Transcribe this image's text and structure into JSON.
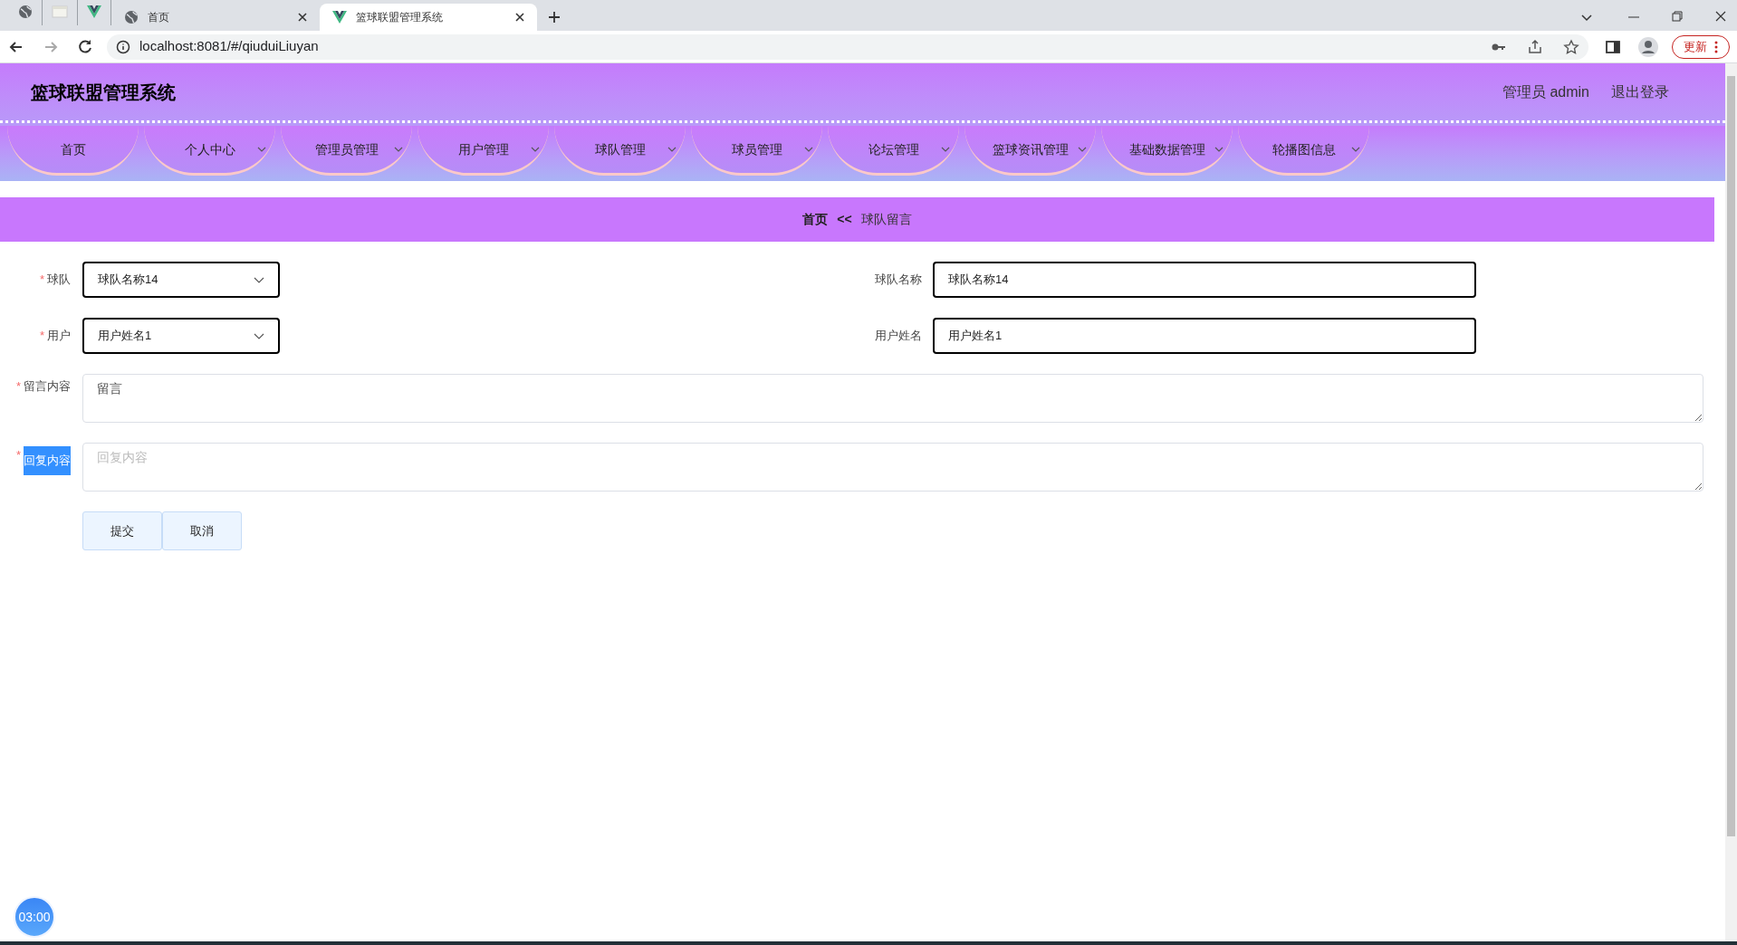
{
  "browser": {
    "tabs": [
      {
        "kind": "globe",
        "selected": false
      },
      {
        "kind": "page",
        "selected": false
      },
      {
        "kind": "vue",
        "selected": false
      },
      {
        "kind": "globe",
        "title": "首页",
        "selected": false
      },
      {
        "kind": "vue",
        "title": "篮球联盟管理系统",
        "selected": true
      }
    ],
    "url": "localhost:8081/#/qiuduiLiuyan",
    "update_label": "更新"
  },
  "header": {
    "title": "篮球联盟管理系统",
    "user": "管理员 admin",
    "logout": "退出登录"
  },
  "nav": [
    {
      "label": "首页",
      "dropdown": false
    },
    {
      "label": "个人中心",
      "dropdown": true
    },
    {
      "label": "管理员管理",
      "dropdown": true
    },
    {
      "label": "用户管理",
      "dropdown": true
    },
    {
      "label": "球队管理",
      "dropdown": true
    },
    {
      "label": "球员管理",
      "dropdown": true
    },
    {
      "label": "论坛管理",
      "dropdown": true
    },
    {
      "label": "篮球资讯管理",
      "dropdown": true
    },
    {
      "label": "基础数据管理",
      "dropdown": true
    },
    {
      "label": "轮播图信息",
      "dropdown": true
    }
  ],
  "breadcrumb": {
    "home": "首页",
    "separator": "<<",
    "current": "球队留言"
  },
  "form": {
    "rows": [
      {
        "label": "球队",
        "required_mark": "*",
        "select_value": "球队名称14",
        "side_label": "球队名称",
        "side_value": "球队名称14"
      },
      {
        "label": "用户",
        "required_mark": "*",
        "select_value": "用户姓名1",
        "side_label": "用户姓名",
        "side_value": "用户姓名1"
      }
    ],
    "textareas": [
      {
        "label": "留言内容",
        "required_mark": "*",
        "highlighted": false,
        "value": "留言"
      },
      {
        "label": "回复内容",
        "required_mark": "*",
        "highlighted": true,
        "placeholder": "回复内容"
      }
    ],
    "buttons": [
      "提交",
      "取消"
    ]
  },
  "timer": "03:00"
}
